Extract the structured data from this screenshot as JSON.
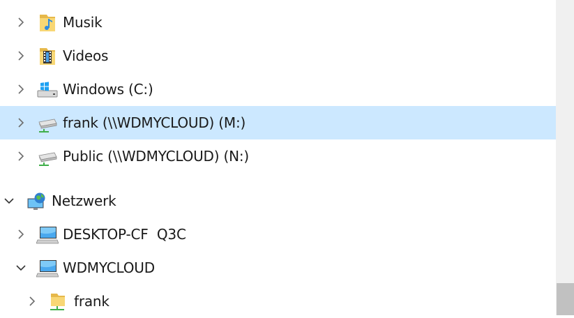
{
  "tree": {
    "items": [
      {
        "label": "Musik",
        "icon": "music-folder-icon",
        "expanded": false
      },
      {
        "label": "Videos",
        "icon": "video-folder-icon",
        "expanded": false
      },
      {
        "label": "Windows (C:)",
        "icon": "windows-drive-icon",
        "expanded": false
      },
      {
        "label": "frank (\\\\WDMYCLOUD) (M:)",
        "icon": "network-drive-icon",
        "expanded": false,
        "selected": true
      },
      {
        "label": "Public (\\\\WDMYCLOUD) (N:)",
        "icon": "network-drive-icon",
        "expanded": false
      },
      {
        "label": "Netzwerk",
        "icon": "network-globe-icon",
        "expanded": true
      },
      {
        "label": "DESKTOP-CF  Q3C",
        "icon": "computer-icon",
        "expanded": false
      },
      {
        "label": "WDMYCLOUD",
        "icon": "computer-icon",
        "expanded": true
      },
      {
        "label": "frank",
        "icon": "shared-folder-icon",
        "expanded": false
      }
    ]
  },
  "colors": {
    "selection": "#cce8ff",
    "scrollbar_track": "#f0f0f0",
    "scrollbar_thumb": "#c1c1c1"
  }
}
